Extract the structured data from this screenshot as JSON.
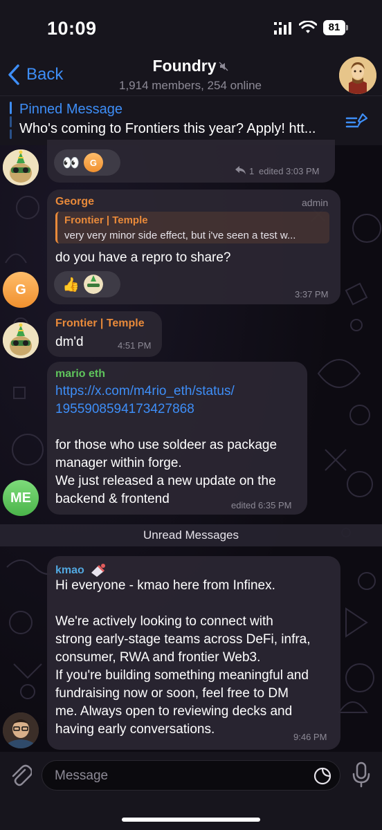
{
  "status_bar": {
    "time": "10:09",
    "battery": "81"
  },
  "header": {
    "back_label": "Back",
    "title": "Foundry",
    "subtitle": "1,914 members, 254 online"
  },
  "pinned": {
    "title": "Pinned Message",
    "text": "Who's coming to Frontiers this year? Apply! htt..."
  },
  "messages": [
    {
      "reactions": [
        {
          "emoji": "👀",
          "avatar_initial": "G"
        }
      ],
      "reply_count": "1",
      "edited_time": "edited 3:03 PM"
    },
    {
      "sender": "George",
      "role": "admin",
      "avatar_initial": "G",
      "reply_to": {
        "name": "Frontier | Temple",
        "text": "very very minor side effect, but i've seen a test w..."
      },
      "text": "do you have a repro to share?",
      "reactions": [
        {
          "emoji": "👍"
        }
      ],
      "time": "3:37 PM"
    },
    {
      "sender": "Frontier | Temple",
      "text": "dm'd",
      "time": "4:51 PM"
    },
    {
      "sender": "mario eth",
      "avatar_initial": "ME",
      "link_line1": "https://x.com/m4rio_eth/status/",
      "link_line2": "1955908594173427868",
      "text_lines": [
        "for those who use soldeer as package",
        "manager within forge.",
        "We just released a new update on the",
        "backend & frontend"
      ],
      "time": "edited 6:35 PM"
    },
    {
      "sender": "kmao",
      "text_lines": [
        "Hi everyone - kmao here from Infinex.",
        "",
        "We're actively looking to connect with",
        "strong early-stage teams across DeFi, infra,",
        "consumer, RWA and frontier Web3.",
        "If you're building something meaningful and",
        "fundraising now or soon, feel free to DM",
        "me. Always open to reviewing decks and",
        "having early conversations."
      ],
      "time": "9:46 PM"
    }
  ],
  "unread_label": "Unread Messages",
  "input": {
    "placeholder": "Message"
  },
  "colors": {
    "accent": "#3e8ef7",
    "reply": "#e98a3a",
    "george": "#e98a3a",
    "temple": "#e98a3a",
    "mario": "#5fc55c",
    "kmao": "#52a8e0"
  }
}
